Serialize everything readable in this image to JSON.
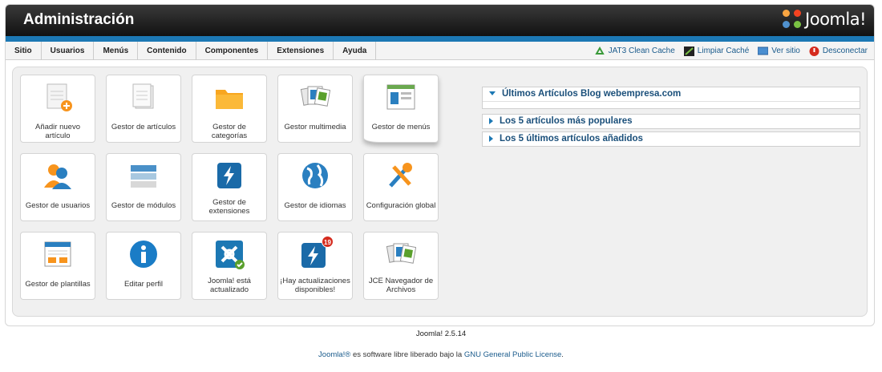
{
  "header": {
    "title": "Administración",
    "logo_text": "Joomla!"
  },
  "menu": [
    "Sitio",
    "Usuarios",
    "Menús",
    "Contenido",
    "Componentes",
    "Extensiones",
    "Ayuda"
  ],
  "status": {
    "cache_label": "JAT3 Clean Cache",
    "clear_cache_label": "Limpiar Caché",
    "view_site_label": "Ver sitio",
    "logout_label": "Desconectar"
  },
  "tiles": [
    {
      "label": "Añadir nuevo artículo",
      "icon": "article-add-icon"
    },
    {
      "label": "Gestor de artículos",
      "icon": "article-icon"
    },
    {
      "label": "Gestor de categorías",
      "icon": "folder-icon"
    },
    {
      "label": "Gestor multimedia",
      "icon": "media-icon"
    },
    {
      "label": "Gestor de menús",
      "icon": "menu-icon"
    },
    {
      "label": "Gestor de usuarios",
      "icon": "users-icon"
    },
    {
      "label": "Gestor de módulos",
      "icon": "modules-icon"
    },
    {
      "label": "Gestor de extensiones",
      "icon": "extensions-icon"
    },
    {
      "label": "Gestor de idiomas",
      "icon": "globe-icon"
    },
    {
      "label": "Configuración global",
      "icon": "config-icon"
    },
    {
      "label": "Gestor de plantillas",
      "icon": "templates-icon"
    },
    {
      "label": "Editar perfil",
      "icon": "info-icon"
    },
    {
      "label": "Joomla! está actualizado",
      "icon": "joomla-ok-icon"
    },
    {
      "label": "¡Hay actualizaciones disponibles!",
      "icon": "updates-icon"
    },
    {
      "label": "JCE Navegador de Archivos",
      "icon": "jce-files-icon"
    }
  ],
  "updates_badge": "19",
  "accordion": [
    {
      "title": "Últimos Artículos Blog webempresa.com",
      "expanded": true
    },
    {
      "title": "Los 5 artículos más populares",
      "expanded": false
    },
    {
      "title": "Los 5 últimos artículos añadidos",
      "expanded": false
    }
  ],
  "footer": {
    "version": "Joomla! 2.5.14",
    "license_link1": "Joomla!®",
    "license_text": " es software libre liberado bajo la ",
    "license_link2": "GNU General Public License",
    "license_end": "."
  },
  "colors": {
    "brand_blue": "#1c78b4",
    "link": "#1a5b8c"
  }
}
